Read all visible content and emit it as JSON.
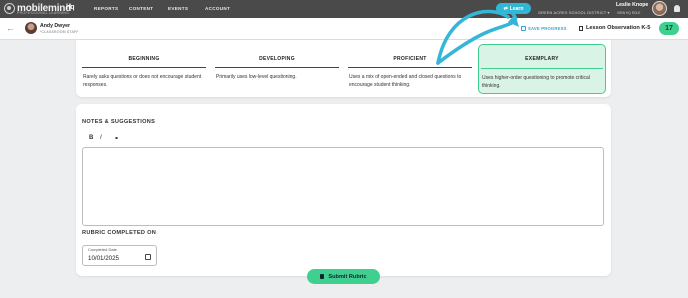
{
  "nav": {
    "logo_text": "mobilemind",
    "logo_sub": "PROFESSIONAL LEARNING",
    "hq": "hq",
    "items": [
      "REPORTS",
      "CONTENT",
      "EVENTS",
      "ACCOUNT"
    ],
    "learn_label": "Learn",
    "user_name": "Leslie Knope",
    "district": "GREEN ACRES SCHOOL DISTRICT",
    "user_role": "VIEW HQ ROLE"
  },
  "subheader": {
    "teacher_name": "Andy Dwyer",
    "teacher_role": "*CLASSROOM STAFF",
    "save_progress": "SAVE PROGRESS",
    "observation_title": "Lesson Observation K-5",
    "count": "17"
  },
  "rubric": {
    "levels": [
      {
        "title": "BEGINNING",
        "desc": "Rarely asks questions or does not encourage student responses."
      },
      {
        "title": "DEVELOPING",
        "desc": "Primarily uses low-level questioning."
      },
      {
        "title": "PROFICIENT",
        "desc": "Uses a mix of open-ended and closed questions to encourage student thinking."
      },
      {
        "title": "EXEMPLARY",
        "desc": "Uses higher-order questioning to promote critical thinking."
      }
    ],
    "selected": "EXEMPLARY"
  },
  "notes": {
    "title": "NOTES & SUGGESTIONS",
    "bold": "B",
    "italic": "I",
    "link": "⚭",
    "completed_title": "RUBRIC COMPLETED ON",
    "date_label": "Completed Date",
    "date_value": "10/01/2025"
  },
  "submit_label": "Submit Rubric",
  "colors": {
    "accent_teal": "#35a6c9",
    "accent_green": "#3fcf8e",
    "nav_bg": "#4a4a4a"
  }
}
